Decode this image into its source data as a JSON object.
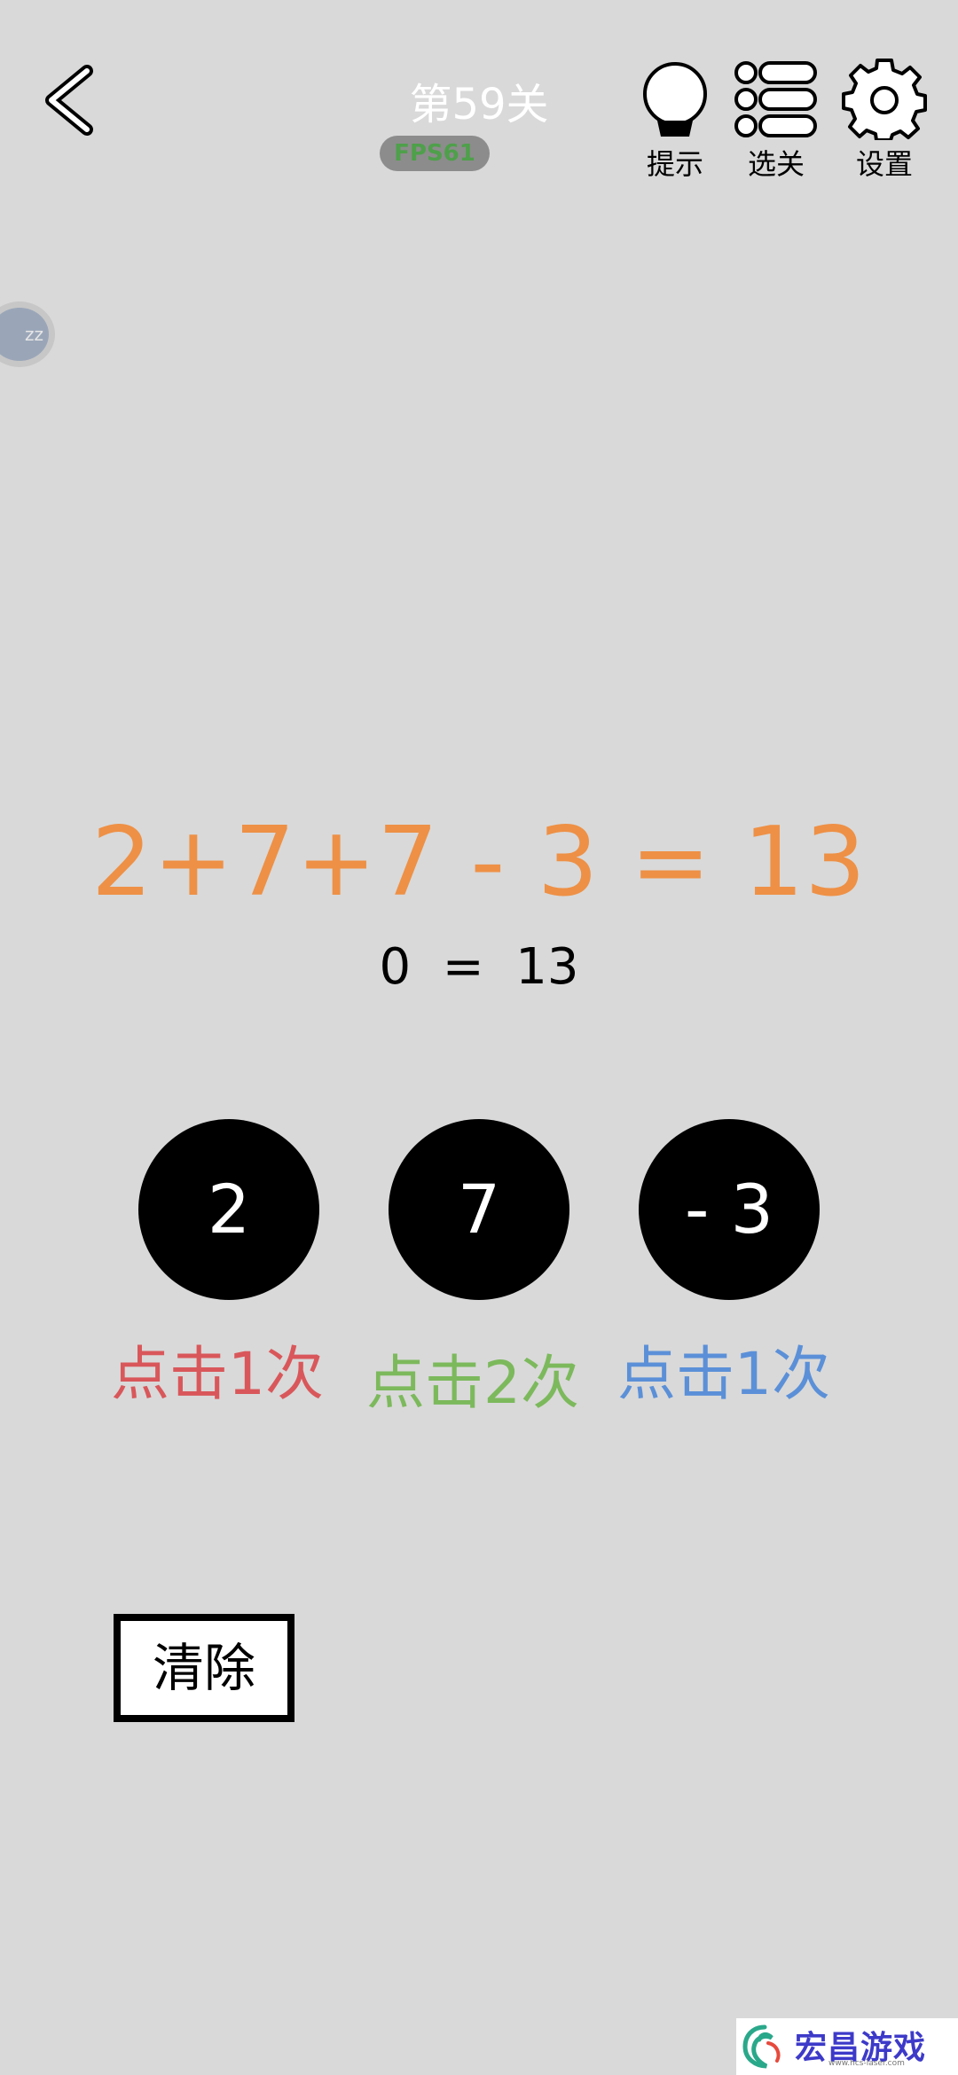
{
  "header": {
    "level_title": "第59关",
    "fps_label": "FPS61",
    "tools": [
      {
        "label": "提示",
        "icon": "lightbulb-icon"
      },
      {
        "label": "选关",
        "icon": "level-list-icon"
      },
      {
        "label": "设置",
        "icon": "gear-icon"
      }
    ]
  },
  "assist_bubble": {
    "text": "zz"
  },
  "puzzle": {
    "equation": "2+7+7 - 3 = 13",
    "current_result": "0  =  13"
  },
  "number_buttons": [
    {
      "label": "2",
      "hint": "点击1次",
      "hint_color": "#d9575a"
    },
    {
      "label": "7",
      "hint": "点击2次",
      "hint_color": "#7cb95c"
    },
    {
      "label": "- 3",
      "hint": "点击1次",
      "hint_color": "#5b90d8"
    }
  ],
  "clear_button": {
    "label": "清除"
  },
  "watermark": {
    "text": "宏昌游戏网",
    "url": "www.hcs-laser.com"
  },
  "colors": {
    "background": "#d9d9d9",
    "equation": "#ee9045",
    "button_bg": "#000000"
  }
}
